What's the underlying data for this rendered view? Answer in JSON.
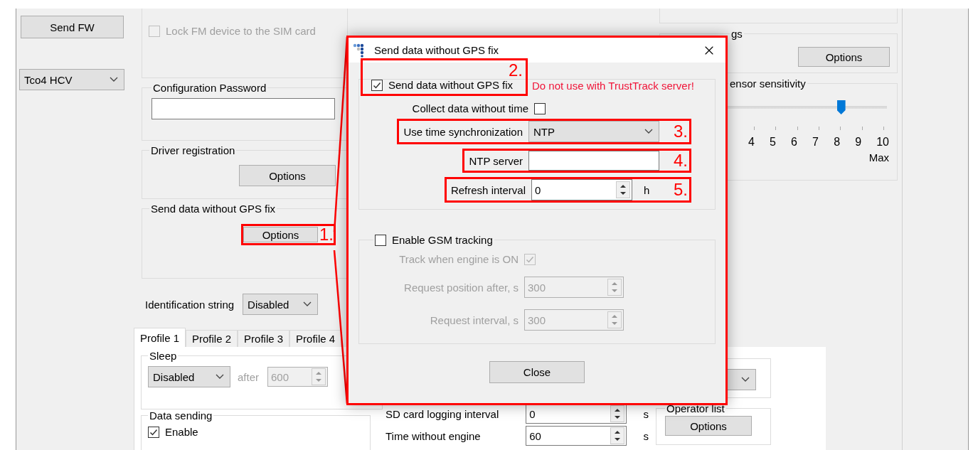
{
  "left_panel": {
    "send_fw_button": "Send FW",
    "device_select": "Tco4 HCV"
  },
  "sim_lock": {
    "label": "Lock FM device to the SIM card",
    "checked": false,
    "disabled": true
  },
  "config_password": {
    "title": "Configuration Password"
  },
  "driver_registration": {
    "title": "Driver registration",
    "button": "Options"
  },
  "gps_fix_group": {
    "title": "Send data without GPS fix",
    "button": "Options",
    "step": "1."
  },
  "identification": {
    "label": "Identification string",
    "value": "Disabled"
  },
  "profile_tabs": [
    {
      "label": "Profile 1",
      "selected": true
    },
    {
      "label": "Profile 2",
      "selected": false
    },
    {
      "label": "Profile 3",
      "selected": false
    },
    {
      "label": "Profile 4",
      "selected": false
    }
  ],
  "sleep": {
    "title": "Sleep",
    "mode": "Disabled",
    "after_label": "after",
    "after_value": "600"
  },
  "data_sending": {
    "title": "Data sending",
    "enable": {
      "label": "Enable",
      "checked": true
    }
  },
  "intervals": [
    {
      "label": "SD card logging interval",
      "value": "0",
      "unit": "s"
    },
    {
      "label": "Time without engine",
      "value": "60",
      "unit": "s"
    }
  ],
  "operator_list": {
    "title": "Operator list",
    "button": "Options"
  },
  "settings_group": {
    "title": "gs",
    "button": "Options"
  },
  "sensitivity": {
    "title": "ensor sensitivity",
    "ticks": [
      "4",
      "5",
      "6",
      "7",
      "8",
      "9",
      "10"
    ],
    "max_label": "Max",
    "level": 0.778
  },
  "dialog": {
    "title": "Send data without GPS fix",
    "main_check": {
      "label": "Send data without GPS fix",
      "checked": true,
      "step": "2."
    },
    "warning": "Do not use with TrustTrack server!",
    "rows": [
      {
        "kind": "checkbox",
        "label": "Collect data without time",
        "checked": false
      },
      {
        "kind": "select",
        "label": "Use time synchronization",
        "value": "NTP",
        "step": "3."
      },
      {
        "kind": "text",
        "label": "NTP server",
        "step": "4."
      },
      {
        "kind": "spinner",
        "label": "Refresh interval",
        "value": "0",
        "unit": "h",
        "step": "5."
      }
    ],
    "gsm": {
      "label": "Enable GSM tracking",
      "checked": false,
      "rows": [
        {
          "kind": "checkbox",
          "label": "Track when engine is ON",
          "checked": true,
          "disabled": true
        },
        {
          "kind": "spinner",
          "label": "Request position after, s",
          "value": "300",
          "disabled": true
        },
        {
          "kind": "spinner",
          "label": "Request interval, s",
          "value": "300",
          "disabled": true
        }
      ]
    },
    "close_button": "Close"
  }
}
